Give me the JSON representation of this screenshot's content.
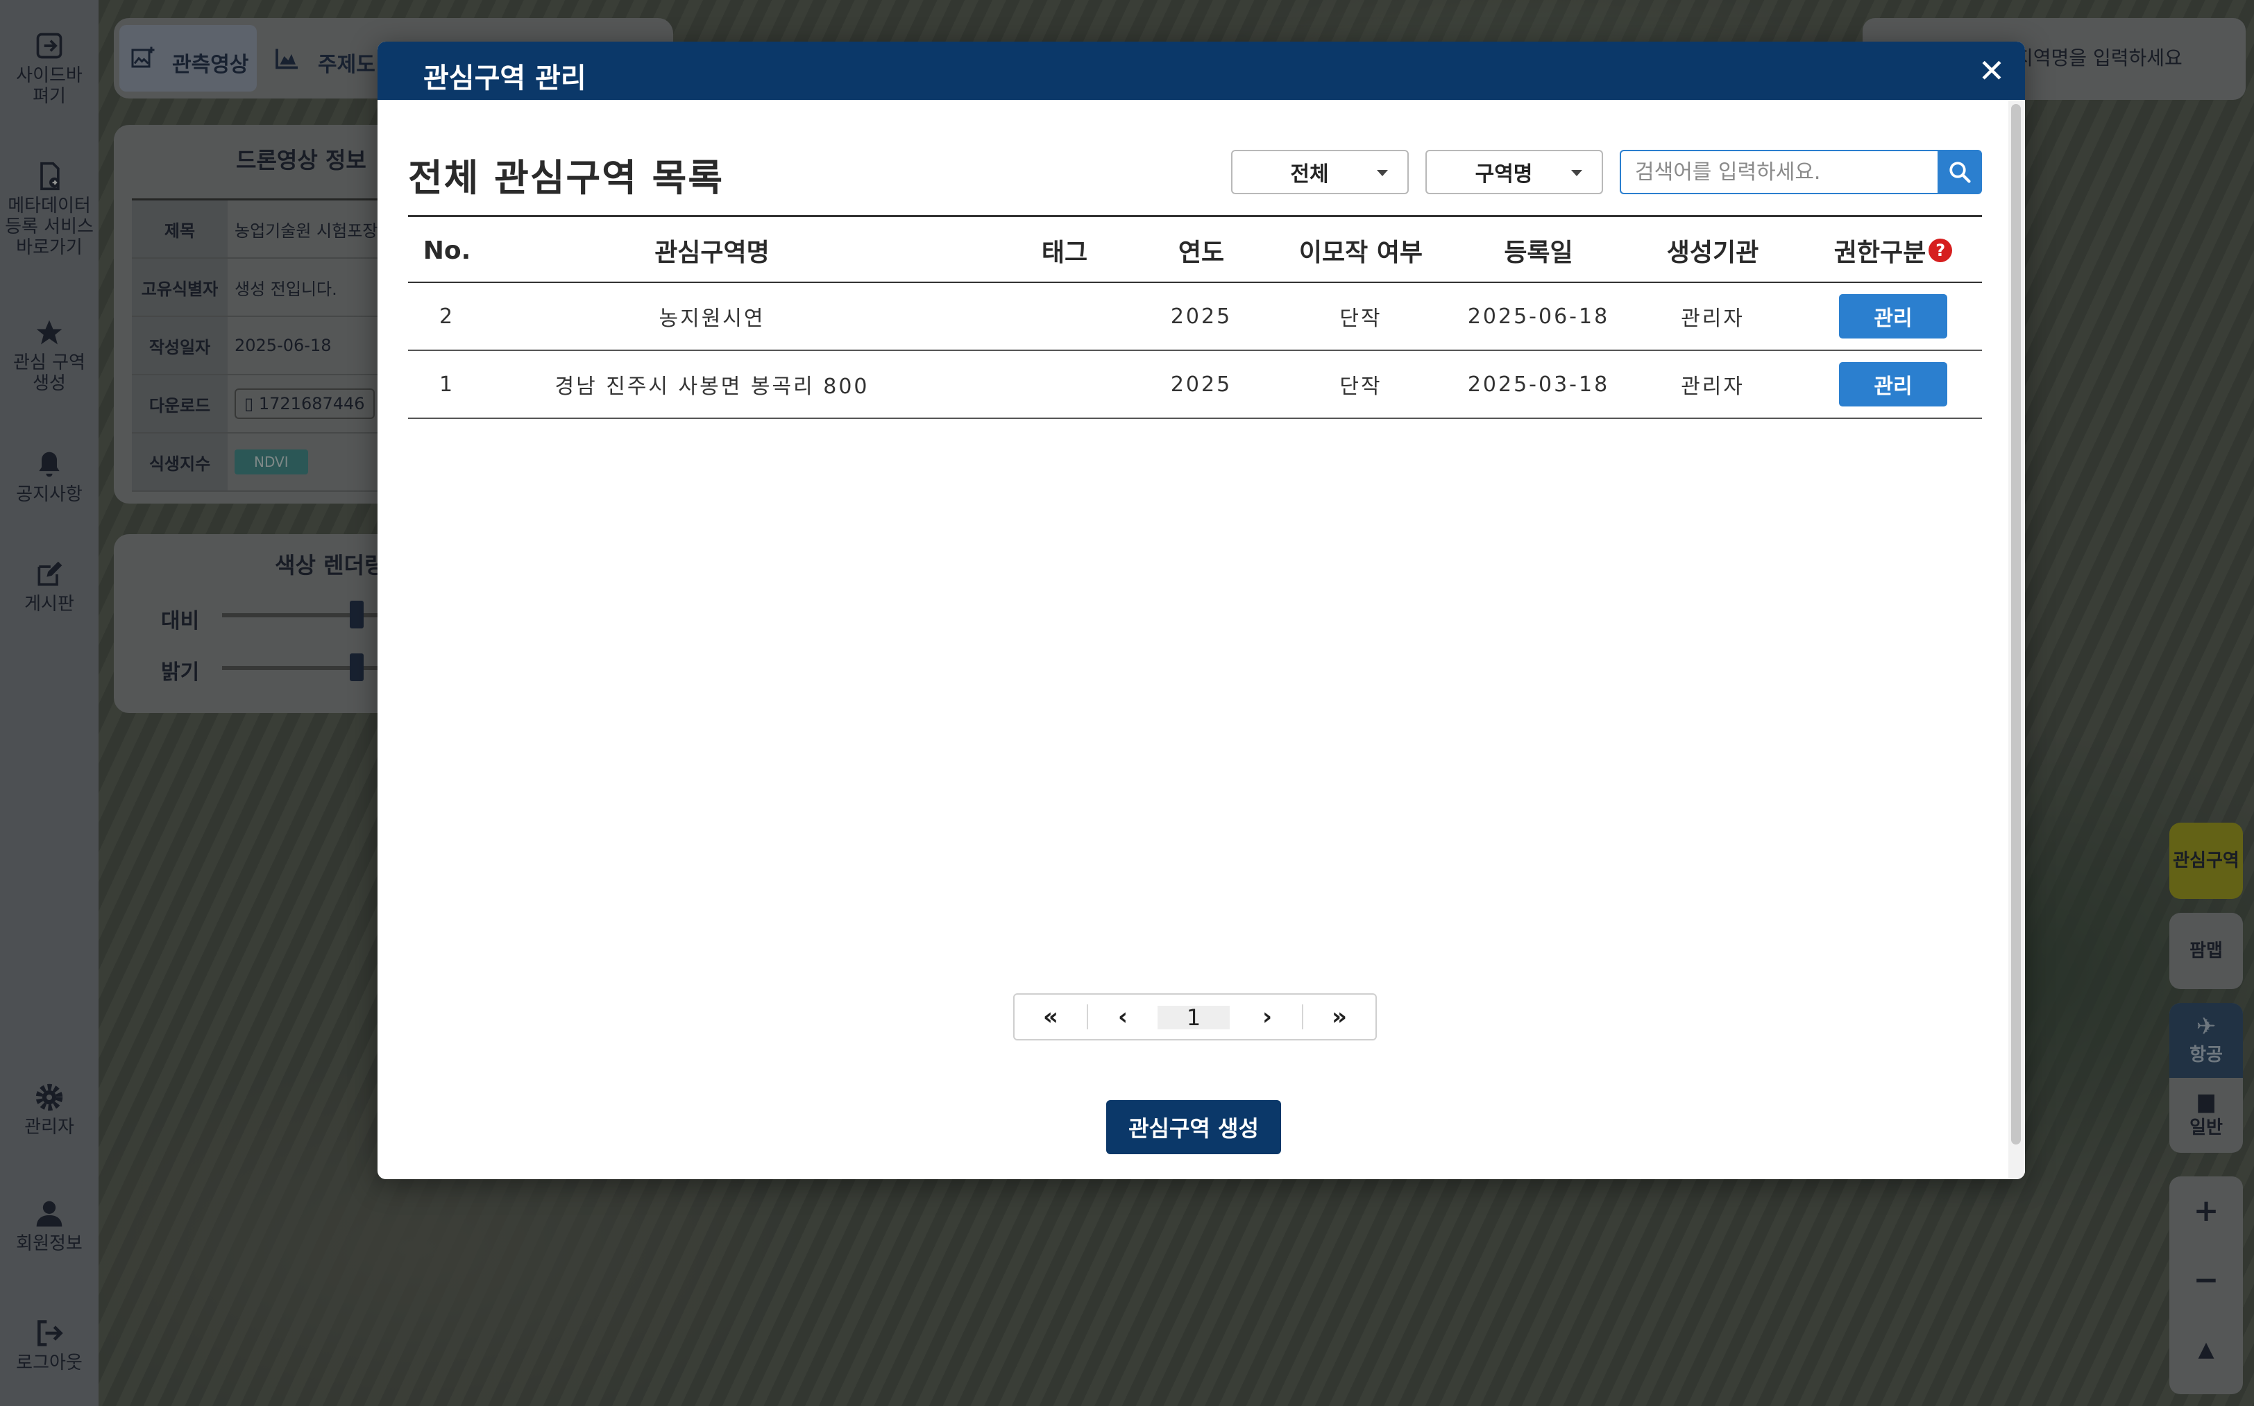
{
  "sidebar": {
    "items": [
      {
        "label": "사이드바\n펴기",
        "icon": "sidebar-expand-icon"
      },
      {
        "label": "메타데이터\n등록 서비스\n바로가기",
        "icon": "metadata-link-icon"
      },
      {
        "label": "관심 구역\n생성",
        "icon": "star-icon"
      },
      {
        "label": "공지사항",
        "icon": "bell-icon"
      },
      {
        "label": "게시판",
        "icon": "edit-icon"
      },
      {
        "label": "관리자",
        "icon": "gear-icon"
      },
      {
        "label": "회원정보",
        "icon": "user-icon"
      },
      {
        "label": "로그아웃",
        "icon": "logout-icon"
      }
    ]
  },
  "top_tabs": {
    "observation": "관측영상",
    "thematic": "주제도"
  },
  "drone_info": {
    "title": "드론영상 정보",
    "rows": [
      {
        "key": "제목",
        "value": "농업기술원 시험포장"
      },
      {
        "key": "고유식별자",
        "value": "생성 전입니다."
      },
      {
        "key": "작성일자",
        "value": "2025-06-18"
      },
      {
        "key": "다운로드",
        "value": "1721687446"
      },
      {
        "key": "식생지수",
        "value": "NDVI"
      }
    ]
  },
  "color_render": {
    "title": "색상 렌더링",
    "contrast": "대비",
    "brightness": "밝기",
    "contrast_level": 0.4,
    "brightness_level": 0.4
  },
  "map_search": {
    "placeholder": "지역명을 입력하세요"
  },
  "right_controls": {
    "aoi": "관심구역",
    "pamphlet": "팜맵",
    "aerial": "항공",
    "general": "일반",
    "zoom_in": "+",
    "zoom_out": "−"
  },
  "modal": {
    "title": "관심구역 관리",
    "list_title": "전체 관심구역 목록",
    "filter_all": "전체",
    "filter_field": "구역명",
    "search_placeholder": "검색어를 입력하세요.",
    "columns": [
      "No.",
      "관심구역명",
      "태그",
      "연도",
      "이모작 여부",
      "등록일",
      "생성기관",
      "권한구분"
    ],
    "help_mark": "?",
    "rows": [
      {
        "no": "2",
        "name": "농지원시연",
        "tag": "",
        "year": "2025",
        "double_crop": "단작",
        "registered": "2025-06-18",
        "org": "관리자",
        "action": "관리"
      },
      {
        "no": "1",
        "name": "경남 진주시 사봉면 봉곡리 800",
        "tag": "",
        "year": "2025",
        "double_crop": "단작",
        "registered": "2025-03-18",
        "org": "관리자",
        "action": "관리"
      }
    ],
    "pagination": {
      "first": "«",
      "prev": "‹",
      "current": "1",
      "next": "›",
      "last": "»"
    },
    "create_button": "관심구역 생성",
    "close": "✕"
  },
  "colors": {
    "header": "#0b3869",
    "primary": "#2b7fcf",
    "aoi_button": "#a4a118"
  }
}
